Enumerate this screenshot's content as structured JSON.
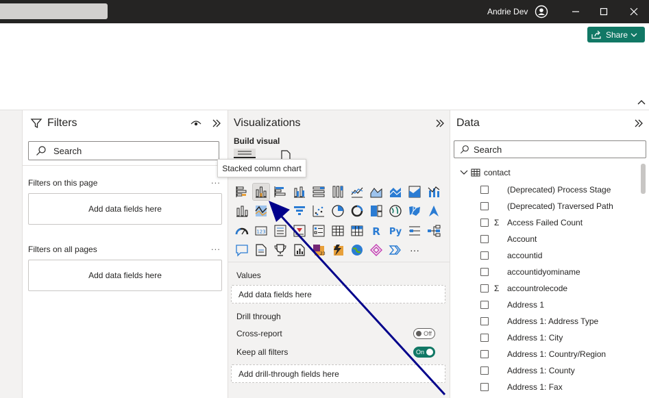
{
  "titlebar": {
    "user_name": "Andrie Dev",
    "icons": [
      "user-avatar-icon",
      "minimize-icon",
      "maximize-icon",
      "close-icon"
    ]
  },
  "ribbon": {
    "share_label": "Share",
    "share_color": "#117865"
  },
  "filters": {
    "title": "Filters",
    "search_placeholder": "Search",
    "on_this_page_label": "Filters on this page",
    "on_this_page_well": "Add data fields here",
    "on_all_pages_label": "Filters on all pages",
    "on_all_pages_well": "Add data fields here",
    "more": "..."
  },
  "visualizations": {
    "title": "Visualizations",
    "build_visual_label": "Build visual",
    "tooltip": "Stacked column chart",
    "selected_visual": "stacked-column-chart",
    "values_label": "Values",
    "values_well": "Add data fields here",
    "drill_through_label": "Drill through",
    "cross_report_label": "Cross-report",
    "cross_report_toggle": "Off",
    "keep_filters_label": "Keep all filters",
    "keep_filters_toggle": "On",
    "drill_well": "Add drill-through fields here",
    "r_label": "R",
    "py_label": "Py",
    "card_label": "123",
    "more_label": "···"
  },
  "data": {
    "title": "Data",
    "search_placeholder": "Search",
    "table_name": "contact",
    "fields": [
      {
        "label": "(Deprecated) Process Stage",
        "sum": false
      },
      {
        "label": "(Deprecated) Traversed Path",
        "sum": false
      },
      {
        "label": "Access Failed Count",
        "sum": true
      },
      {
        "label": "Account",
        "sum": false
      },
      {
        "label": "accountid",
        "sum": false
      },
      {
        "label": "accountidyominame",
        "sum": false
      },
      {
        "label": "accountrolecode",
        "sum": true
      },
      {
        "label": "Address 1",
        "sum": false
      },
      {
        "label": "Address 1: Address Type",
        "sum": false
      },
      {
        "label": "Address 1: City",
        "sum": false
      },
      {
        "label": "Address 1: Country/Region",
        "sum": false
      },
      {
        "label": "Address 1: County",
        "sum": false
      },
      {
        "label": "Address 1: Fax",
        "sum": false
      }
    ],
    "sigma": "Σ"
  },
  "annotation_color": "#00008b"
}
